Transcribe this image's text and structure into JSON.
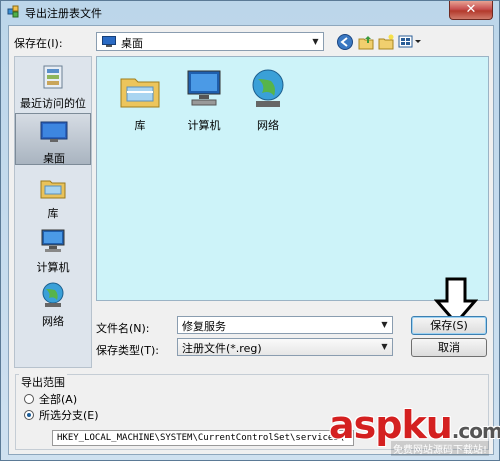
{
  "window": {
    "title": "导出注册表文件",
    "close_label": "✕"
  },
  "toolbar": {
    "save_in_label": "保存在(I):",
    "save_in_value": "桌面",
    "icons": [
      "back-icon",
      "up-folder-icon",
      "new-folder-icon",
      "view-menu-icon"
    ]
  },
  "places": [
    {
      "label": "最近访问的位置",
      "icon": "recent-places-icon"
    },
    {
      "label": "桌面",
      "icon": "desktop-icon",
      "selected": true
    },
    {
      "label": "库",
      "icon": "libraries-icon"
    },
    {
      "label": "计算机",
      "icon": "computer-icon"
    },
    {
      "label": "网络",
      "icon": "network-icon"
    }
  ],
  "items": [
    {
      "label": "库",
      "icon": "libraries-icon"
    },
    {
      "label": "计算机",
      "icon": "computer-icon"
    },
    {
      "label": "网络",
      "icon": "network-icon"
    }
  ],
  "form": {
    "filename_label": "文件名(N):",
    "filename_value": "修复服务",
    "filetype_label": "保存类型(T):",
    "filetype_value": "注册文件(*.reg)",
    "save_button": "保存(S)",
    "cancel_button": "取消"
  },
  "export_range": {
    "group_label": "导出范围",
    "all_label": "全部(A)",
    "selected_label": "所选分支(E)",
    "selected_checked": true,
    "branch_path": "HKEY_LOCAL_MACHINE\\SYSTEM\\CurrentControlSet\\services\\"
  },
  "watermark": {
    "brand": "aspku",
    "domain": ".com",
    "tagline": "免费网站源码下载站!"
  },
  "colors": {
    "list_bg": "#cdf3f9",
    "close_red": "#c75050",
    "watermark": "#d42020"
  }
}
